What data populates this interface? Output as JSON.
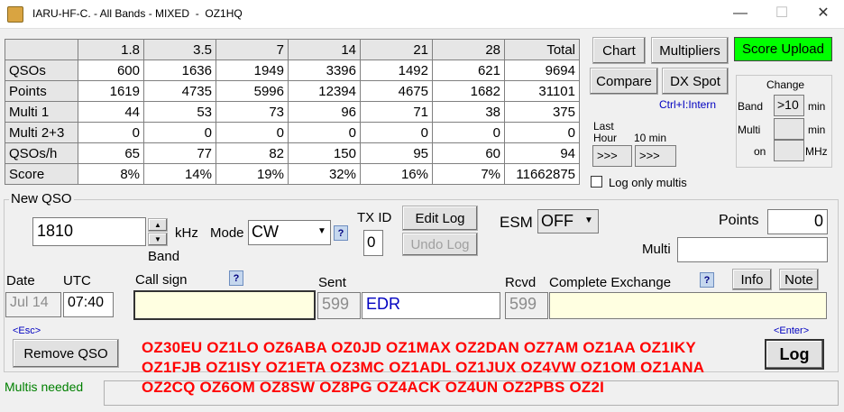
{
  "window": {
    "title": "IARU-HF-C. - All Bands - MIXED  -  OZ1HQ",
    "minimize": "—",
    "maximize": "☐",
    "close": "✕"
  },
  "stats": {
    "columns": [
      "",
      "1.8",
      "3.5",
      "7",
      "14",
      "21",
      "28",
      "Total"
    ],
    "rows": [
      {
        "label": "QSOs",
        "values": [
          "600",
          "1636",
          "1949",
          "3396",
          "1492",
          "621",
          "9694"
        ]
      },
      {
        "label": "Points",
        "values": [
          "1619",
          "4735",
          "5996",
          "12394",
          "4675",
          "1682",
          "31101"
        ]
      },
      {
        "label": "Multi 1",
        "values": [
          "44",
          "53",
          "73",
          "96",
          "71",
          "38",
          "375"
        ]
      },
      {
        "label": "Multi 2+3",
        "values": [
          "0",
          "0",
          "0",
          "0",
          "0",
          "0",
          "0"
        ]
      },
      {
        "label": "QSOs/h",
        "values": [
          "65",
          "77",
          "82",
          "150",
          "95",
          "60",
          "94"
        ]
      },
      {
        "label": "Score",
        "values": [
          "8%",
          "14%",
          "19%",
          "32%",
          "16%",
          "7%",
          "11662875"
        ]
      }
    ]
  },
  "right_panel": {
    "chart": "Chart",
    "multipliers": "Multipliers",
    "score_upload": "Score Upload",
    "compare": "Compare",
    "dx_spot": "DX Spot",
    "ctrl_hint": "Ctrl+I:Intern",
    "last_hour_label": "Last",
    "last_hour_label2": "Hour",
    "ten_min_label": "10 min",
    "last_hour_value": ">>>",
    "ten_min_value": ">>>",
    "log_only_multis": "Log only multis",
    "change": {
      "title": "Change",
      "band_label": "Band",
      "band_value": ">10",
      "band_unit": "min",
      "multi_label": "Multi",
      "multi_value": "",
      "multi_unit": "min",
      "on_label": "on",
      "on_value": "",
      "on_unit": "MHz"
    }
  },
  "new_qso": {
    "group_title": "New QSO",
    "freq_value": "1810",
    "khz": "kHz",
    "band": "Band",
    "mode_label": "Mode",
    "mode_value": "CW",
    "help": "?",
    "txid_label": "TX ID",
    "txid_value": "0",
    "edit_log": "Edit Log",
    "undo_log": "Undo Log",
    "esm_label": "ESM",
    "esm_value": "OFF",
    "points_label": "Points",
    "points_value": "0",
    "multi_label": "Multi",
    "multi_value": "",
    "date_label": "Date",
    "date_value": "Jul 14",
    "utc_label": "UTC",
    "utc_value": "07:40",
    "callsign_label": "Call sign",
    "callsign_value": "",
    "sent_label": "Sent",
    "sent_rst": "599",
    "sent_exchange": "EDR",
    "rcvd_label": "Rcvd",
    "rcvd_rst": "599",
    "complete_exchange_label": "Complete Exchange",
    "complete_exchange_value": "",
    "info": "Info",
    "note": "Note",
    "esc_hint": "<Esc>",
    "enter_hint": "<Enter>",
    "remove_qso": "Remove QSO",
    "log": "Log"
  },
  "calls_needed": [
    "OZ30EU OZ1LO OZ6ABA OZ0JD OZ1MAX OZ2DAN OZ7AM OZ1AA OZ1IKY",
    "OZ1FJB OZ1ISY OZ1ETA OZ3MC OZ1ADL OZ1JUX OZ4VW OZ1OM OZ1ANA",
    "OZ2CQ OZ6OM OZ8SW OZ8PG OZ4ACK OZ4UN OZ2PBS OZ2I"
  ],
  "status": {
    "text": "Multis needed",
    "color": "#008000"
  }
}
